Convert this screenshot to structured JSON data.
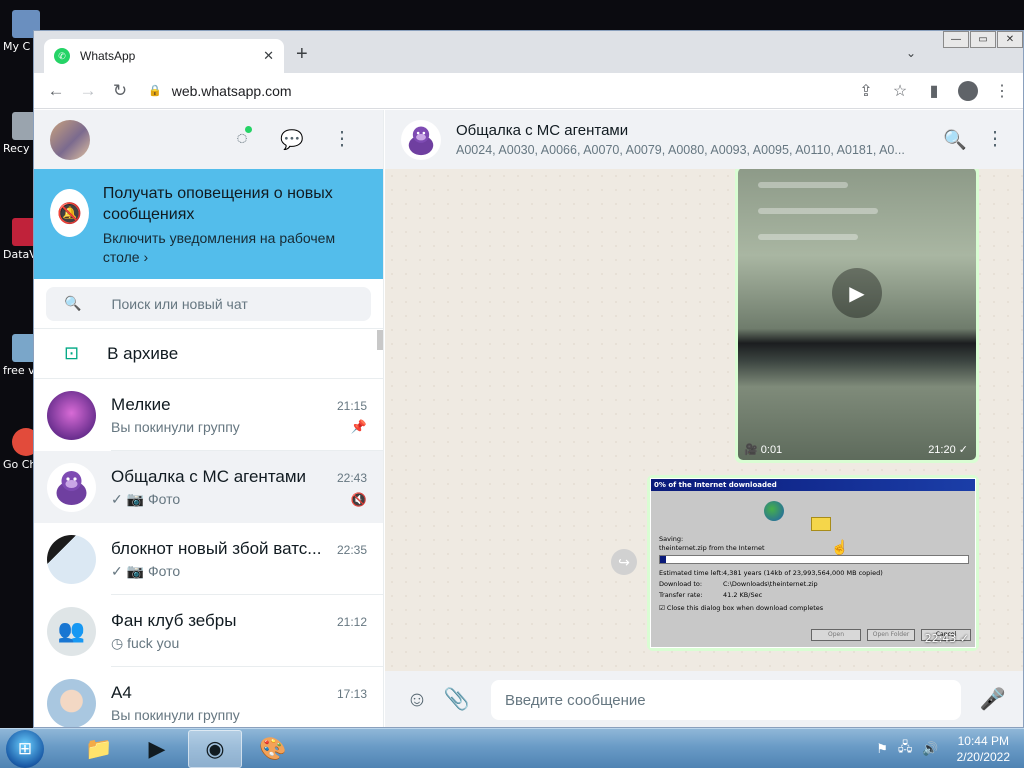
{
  "desktop": {
    "icons": [
      {
        "label": "My C",
        "color": "#6a8fbf"
      },
      {
        "label": "Recy",
        "color": "#9aa4ae"
      },
      {
        "label": "DataV",
        "color": "#c0223a"
      },
      {
        "label": "free v",
        "color": "#7aa6c9"
      },
      {
        "label": "Go Ch",
        "color": "#e24b3b"
      }
    ]
  },
  "browser": {
    "tab_title": "WhatsApp",
    "tab_close": "✕",
    "new_tab": "+",
    "tab_menu": "⌄",
    "url": "web.whatsapp.com",
    "win_controls": [
      "—",
      "▭",
      "✕"
    ]
  },
  "sidebar": {
    "notification": {
      "title": "Получать оповещения о новых сообщениях",
      "subtitle": "Включить уведомления на рабочем столе ›"
    },
    "search_placeholder": "Поиск или новый чат",
    "archive_label": "В архиве",
    "chats": [
      {
        "name": "Мелкие",
        "time": "21:15",
        "last": "Вы покинули группу",
        "flag": "pin-icon",
        "avatar_color": "#9b59b6"
      },
      {
        "name": "Общалка с МС агентами",
        "time": "22:43",
        "last": "✓ 📷 Фото",
        "flag": "mute-icon",
        "avatar_color": "#6f3fa0"
      },
      {
        "name": "блокнот новый збой ватс...",
        "time": "22:35",
        "last": "✓ 📷 Фото",
        "flag": "",
        "avatar_color": "#dfe9f2"
      },
      {
        "name": "Фан клуб зебры",
        "time": "21:12",
        "last": "◷ fuck you",
        "flag": "",
        "avatar_color": "#dfe5e7"
      },
      {
        "name": "А4",
        "time": "17:13",
        "last": "Вы покинули группу",
        "flag": "",
        "avatar_color": "#cfe3f0"
      }
    ]
  },
  "conversation": {
    "name": "Общалка с МС агентами",
    "members": "A0024, A0030, A0066, A0070, A0079, A0080, A0093, A0095, A0110, A0181, A0...",
    "video": {
      "duration": "0:01",
      "time": "21:20 ✓"
    },
    "image": {
      "time": "22:43 ✓",
      "dialog_title": "0% of the Internet downloaded",
      "saving": "Saving:",
      "filename": "theinternet.zip from the Internet",
      "est_label": "Estimated time left:",
      "est_value": "4,381 years (14kb of 23,993,564,000 MB copied)",
      "dl_label": "Download to:",
      "dl_value": "C:\\Downloads\\theinternet.zip",
      "rate_label": "Transfer rate:",
      "rate_value": "41.2 KB/Sec",
      "checkbox": "Close this dialog box when download completes",
      "buttons": [
        "Open",
        "Open Folder",
        "Cancel"
      ]
    },
    "composer_placeholder": "Введите сообщение"
  },
  "taskbar": {
    "time": "10:44 PM",
    "date": "2/20/2022"
  }
}
